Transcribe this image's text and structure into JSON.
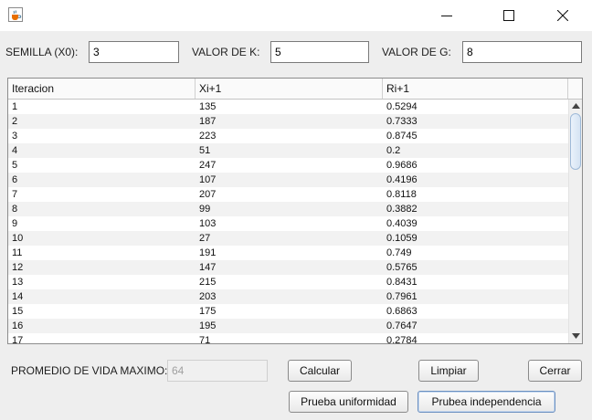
{
  "window": {
    "icon": "java-cup-icon",
    "controls": [
      "minimize-icon",
      "maximize-icon",
      "close-icon"
    ]
  },
  "params": {
    "seed_label": "SEMILLA (X0):",
    "seed_value": "3",
    "k_label": "VALOR DE K:",
    "k_value": "5",
    "g_label": "VALOR DE G:",
    "g_value": "8"
  },
  "table": {
    "columns": [
      "Iteracion",
      "Xi+1",
      "Ri+1"
    ],
    "rows": [
      [
        "1",
        "135",
        "0.5294"
      ],
      [
        "2",
        "187",
        "0.7333"
      ],
      [
        "3",
        "223",
        "0.8745"
      ],
      [
        "4",
        "51",
        "0.2"
      ],
      [
        "5",
        "247",
        "0.9686"
      ],
      [
        "6",
        "107",
        "0.4196"
      ],
      [
        "7",
        "207",
        "0.8118"
      ],
      [
        "8",
        "99",
        "0.3882"
      ],
      [
        "9",
        "103",
        "0.4039"
      ],
      [
        "10",
        "27",
        "0.1059"
      ],
      [
        "11",
        "191",
        "0.749"
      ],
      [
        "12",
        "147",
        "0.5765"
      ],
      [
        "13",
        "215",
        "0.8431"
      ],
      [
        "14",
        "203",
        "0.7961"
      ],
      [
        "15",
        "175",
        "0.6863"
      ],
      [
        "16",
        "195",
        "0.7647"
      ],
      [
        "17",
        "71",
        "0.2784"
      ]
    ]
  },
  "footer": {
    "max_life_label": "PROMEDIO DE VIDA MAXIMO:",
    "max_life_value": "64",
    "calcular": "Calcular",
    "limpiar": "Limpiar",
    "cerrar": "Cerrar",
    "prueba_uniformidad": "Prueba uniformidad",
    "prueba_independencia": "Prubea independencia"
  }
}
